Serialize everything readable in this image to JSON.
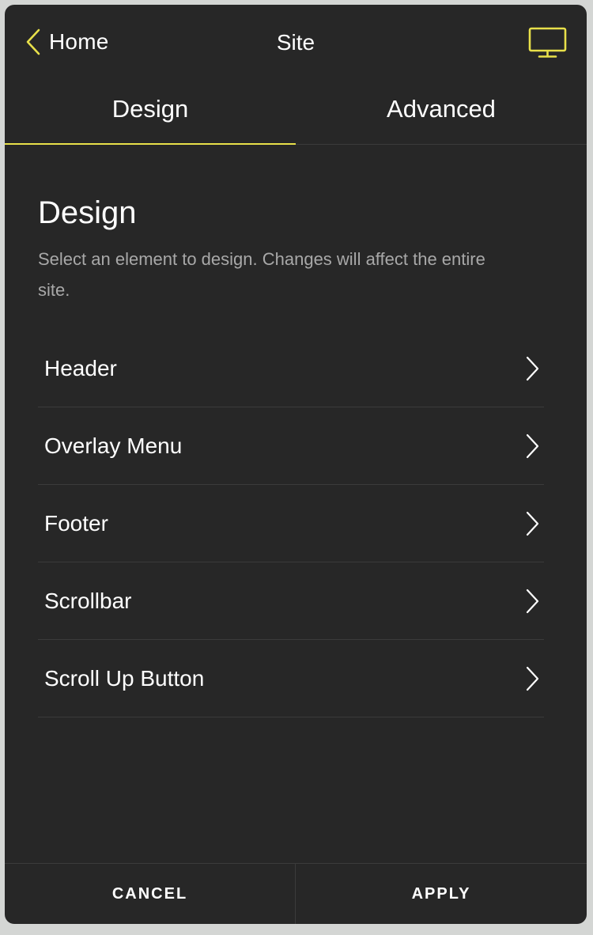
{
  "header": {
    "back_label": "Home",
    "title": "Site",
    "back_icon": "chevron-left-icon",
    "device_icon": "desktop-monitor-icon"
  },
  "tabs": [
    {
      "label": "Design",
      "active": true
    },
    {
      "label": "Advanced",
      "active": false
    }
  ],
  "section": {
    "title": "Design",
    "description": "Select an element to design. Changes will affect the entire site."
  },
  "items": [
    {
      "label": "Header"
    },
    {
      "label": "Overlay Menu"
    },
    {
      "label": "Footer"
    },
    {
      "label": "Scrollbar"
    },
    {
      "label": "Scroll Up Button"
    }
  ],
  "footer": {
    "cancel_label": "CANCEL",
    "apply_label": "APPLY"
  },
  "colors": {
    "accent": "#e8e04a",
    "panel_bg": "#272727",
    "page_bg": "#d4d6d4",
    "muted_text": "#a8a8a8",
    "divider": "#3b3b3b"
  }
}
